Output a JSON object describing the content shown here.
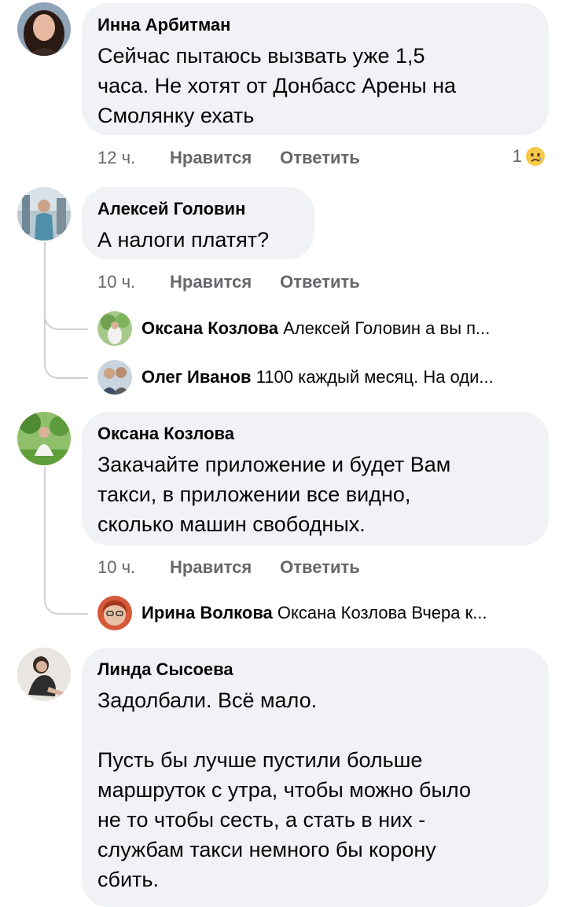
{
  "actions": {
    "like": "Нравится",
    "reply": "Ответить"
  },
  "comments": [
    {
      "author": "Инна Арбитман",
      "text": "Сейчас пытаюсь вызвать уже 1,5\nчаса. Не хотят от Донбасс Арены на\nСмолянку ехать",
      "time": "12 ч.",
      "reaction_count": "1",
      "reaction_icon": "crying-face-emoji"
    },
    {
      "author": "Алексей Головин",
      "text": "А налоги платят?",
      "time": "10 ч.",
      "replies": [
        {
          "author": "Оксана Козлова",
          "preview": "Алексей Головин а вы п..."
        },
        {
          "author": "Олег Иванов",
          "preview": "1100 каждый месяц. На оди..."
        }
      ]
    },
    {
      "author": "Оксана Козлова",
      "text": "Закачайте приложение и будет Вам\nтакси, в приложении все видно,\nсколько машин свободных.",
      "time": "10 ч.",
      "replies": [
        {
          "author": "Ирина Волкова",
          "preview": "Оксана Козлова Вчера к..."
        }
      ]
    },
    {
      "author": "Линда Сысоева",
      "text": "Задолбали. Всё мало.\n\nПусть бы лучше пустили больше\nмаршруток с утра, чтобы можно было\nне то чтобы сесть, а стать в них -\nслужбам такси немного бы корону\nсбить."
    }
  ]
}
